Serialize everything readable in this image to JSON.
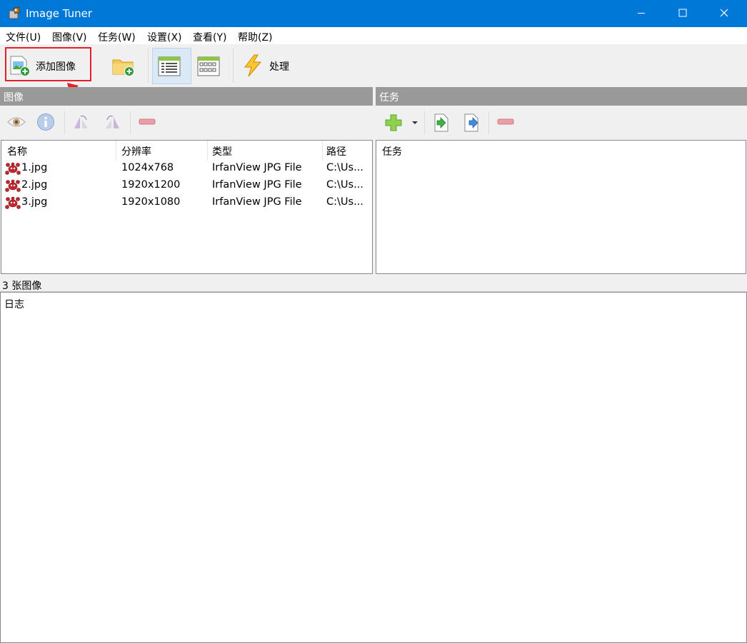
{
  "window": {
    "title": "Image Tuner",
    "icons": [
      "app-icon",
      "minimize-icon",
      "maximize-icon",
      "close-icon"
    ]
  },
  "menu": [
    {
      "label": "文件(U)"
    },
    {
      "label": "图像(V)"
    },
    {
      "label": "任务(W)"
    },
    {
      "label": "设置(X)"
    },
    {
      "label": "查看(Y)"
    },
    {
      "label": "帮助(Z)"
    }
  ],
  "toolbar": {
    "add_image_label": "添加图像",
    "process_label": "处理",
    "icons": [
      "add-image-icon",
      "add-folder-icon",
      "details-view-icon",
      "thumbnail-view-icon",
      "lightning-icon"
    ]
  },
  "images_pane": {
    "header": "图像",
    "icons": [
      "eye-icon",
      "info-icon",
      "rotate-left-icon",
      "rotate-right-icon",
      "remove-icon"
    ],
    "columns": [
      "名称",
      "分辨率",
      "类型",
      "路径"
    ],
    "rows": [
      {
        "name": "1.jpg",
        "resolution": "1024x768",
        "type": "IrfanView JPG File",
        "path": "C:\\Us..."
      },
      {
        "name": "2.jpg",
        "resolution": "1920x1200",
        "type": "IrfanView JPG File",
        "path": "C:\\Us..."
      },
      {
        "name": "3.jpg",
        "resolution": "1920x1080",
        "type": "IrfanView JPG File",
        "path": "C:\\Us..."
      }
    ]
  },
  "tasks_pane": {
    "header": "任务",
    "icons": [
      "add-task-icon",
      "dropdown-arrow-icon",
      "import-task-icon",
      "export-task-icon",
      "remove-task-icon"
    ],
    "column": "任务"
  },
  "status": {
    "text": "3 张图像"
  },
  "log": {
    "label": "日志"
  },
  "colors": {
    "titlebar": "#0078d7",
    "pane_header": "#999999",
    "highlight": "#e51f2a"
  }
}
